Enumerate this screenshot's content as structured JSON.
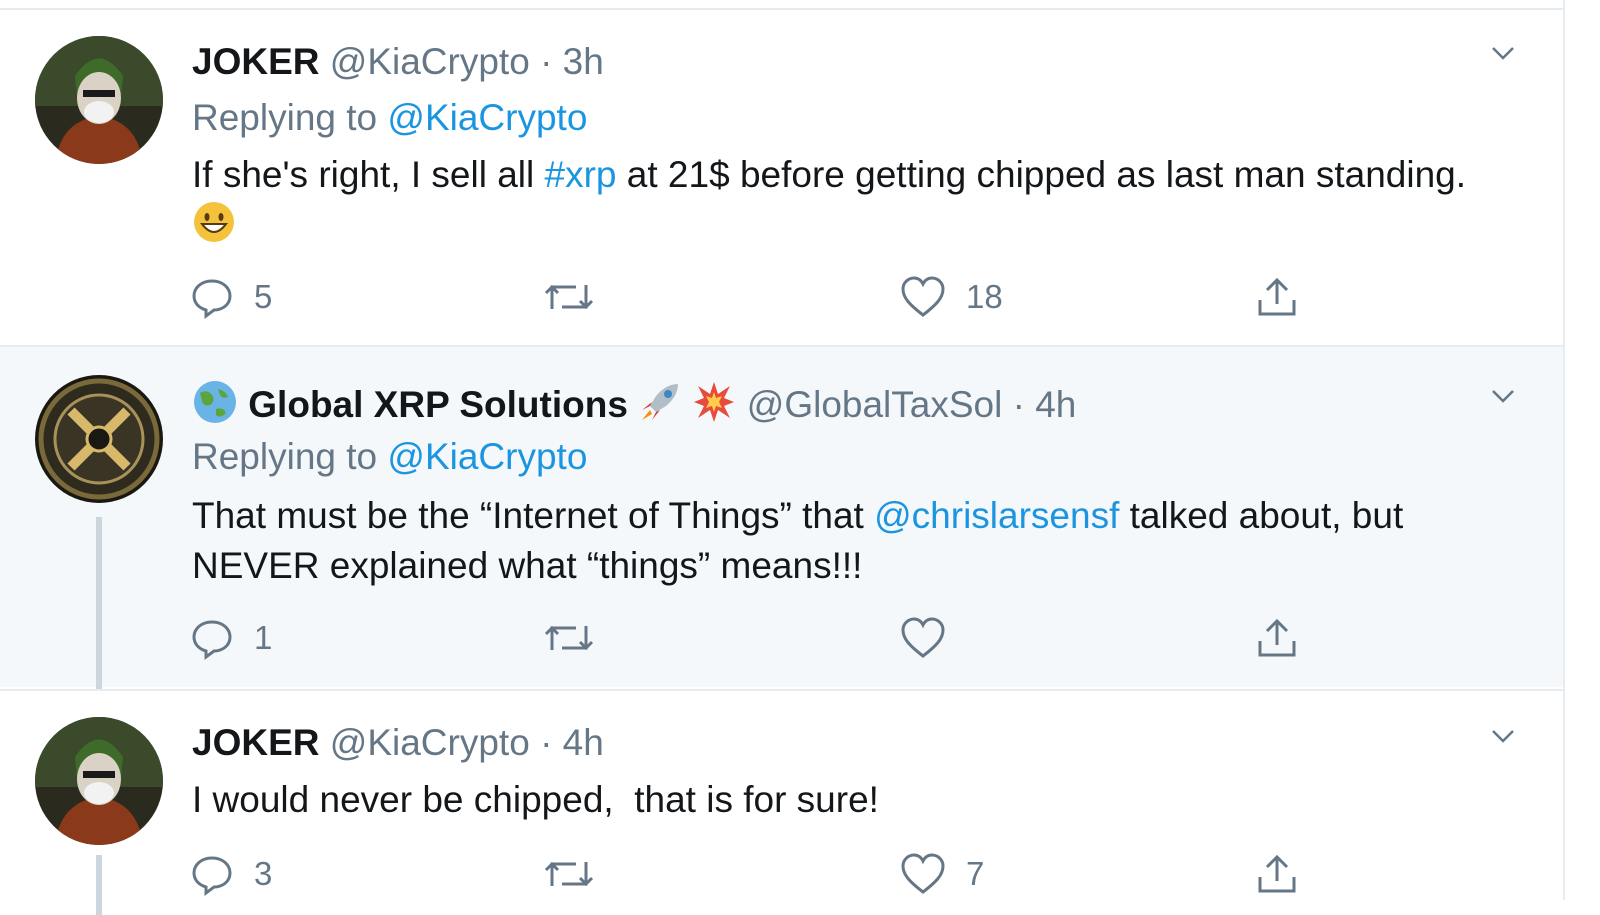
{
  "tweets": [
    {
      "name": "JOKER",
      "handle": "@KiaCrypto",
      "separator": "·",
      "time": "3h",
      "replying_prefix": "Replying to",
      "replying_handle": "@KiaCrypto",
      "text_part1": "If she's right, I sell all ",
      "hashtag": "#xrp",
      "text_part2": " at 21$ before getting chipped as last man standing. ",
      "replies": "5",
      "retweets": "",
      "likes": "18"
    },
    {
      "name": "Global XRP Solutions",
      "handle": "@GlobalTaxSol",
      "separator": "·",
      "time": "4h",
      "replying_prefix": "Replying to",
      "replying_handle": "@KiaCrypto",
      "text_part1": "That must be the “Internet of Things” that ",
      "mention": "@chrislarsensf",
      "text_part2": " talked about, but NEVER explained what “things” means!!!",
      "replies": "1",
      "retweets": "",
      "likes": ""
    },
    {
      "name": "JOKER",
      "handle": "@KiaCrypto",
      "separator": "·",
      "time": "4h",
      "text": "I would never be chipped,  that is for sure!",
      "replies": "3",
      "retweets": "",
      "likes": "7"
    }
  ],
  "icons": {
    "reply": "reply-icon",
    "retweet": "retweet-icon",
    "like": "heart-icon",
    "share": "share-icon",
    "more": "chevron-down-icon"
  },
  "colors": {
    "link": "#1b95e0",
    "secondary_text": "#657786",
    "highlight_bg": "#f5f8fa"
  }
}
